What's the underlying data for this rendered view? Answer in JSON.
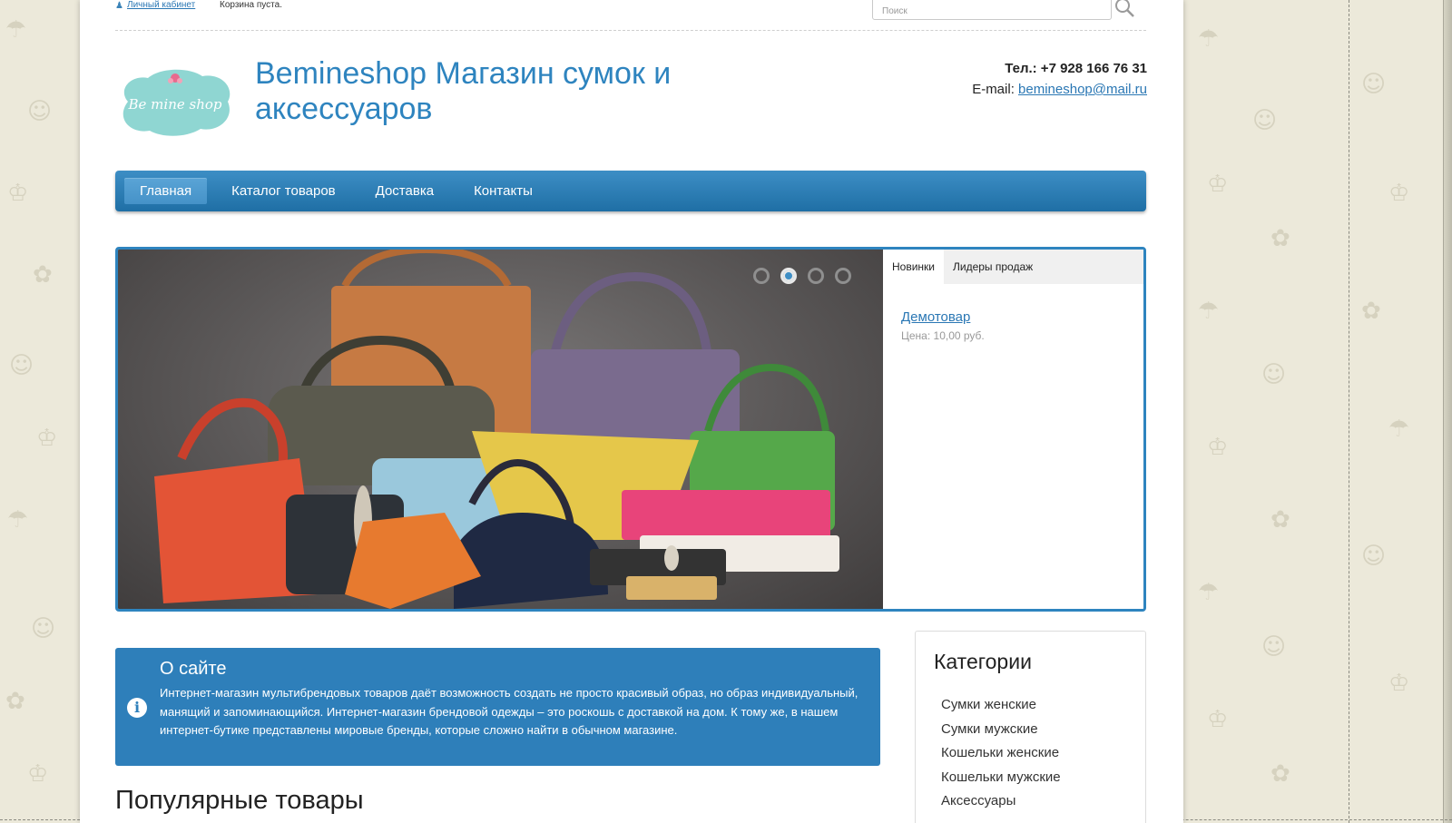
{
  "topbar": {
    "account_link": "Личный кабинет",
    "cart_status": "Корзина пуста.",
    "search_placeholder": "Поиск"
  },
  "header": {
    "logo_text": "Be mine shop",
    "site_title": "Bemineshop Магазин сумок и аксессуаров",
    "phone_label": "Тел.: +7 928 166 76 31",
    "email_label": "E-mail:",
    "email": "bemineshop@mail.ru"
  },
  "nav": {
    "items": [
      {
        "label": "Главная",
        "active": true
      },
      {
        "label": "Каталог товаров"
      },
      {
        "label": "Доставка"
      },
      {
        "label": "Контакты"
      }
    ]
  },
  "slider": {
    "dot_count": 4,
    "active_dot": 2
  },
  "side_tabs": {
    "tabs": [
      {
        "label": "Новинки",
        "active": true
      },
      {
        "label": "Лидеры продаж"
      }
    ],
    "product_name": "Демотовар",
    "product_price": "Цена: 10,00 руб."
  },
  "about": {
    "title": "О сайте",
    "text": "Интернет-магазин мультибрендовых товаров даёт возможность создать не просто красивый образ, но образ индивидуальный, манящий и запоминающийся. Интернет-магазин брендовой одежды – это роскошь с доставкой на дом. К тому же, в нашем интернет-бутике представлены мировые бренды, которые сложно найти в обычном магазине."
  },
  "popular": {
    "title": "Популярные товары"
  },
  "categories": {
    "title": "Категории",
    "items": [
      "Сумки женские",
      "Сумки мужские",
      "Кошельки женские",
      "Кошельки мужские",
      "Аксессуары"
    ]
  },
  "colors": {
    "accent": "#2e84bf",
    "nav_top": "#3d8ec5",
    "nav_bottom": "#1f6fa5",
    "about_bg": "#2e7fba",
    "page_bg": "#ece9da"
  }
}
